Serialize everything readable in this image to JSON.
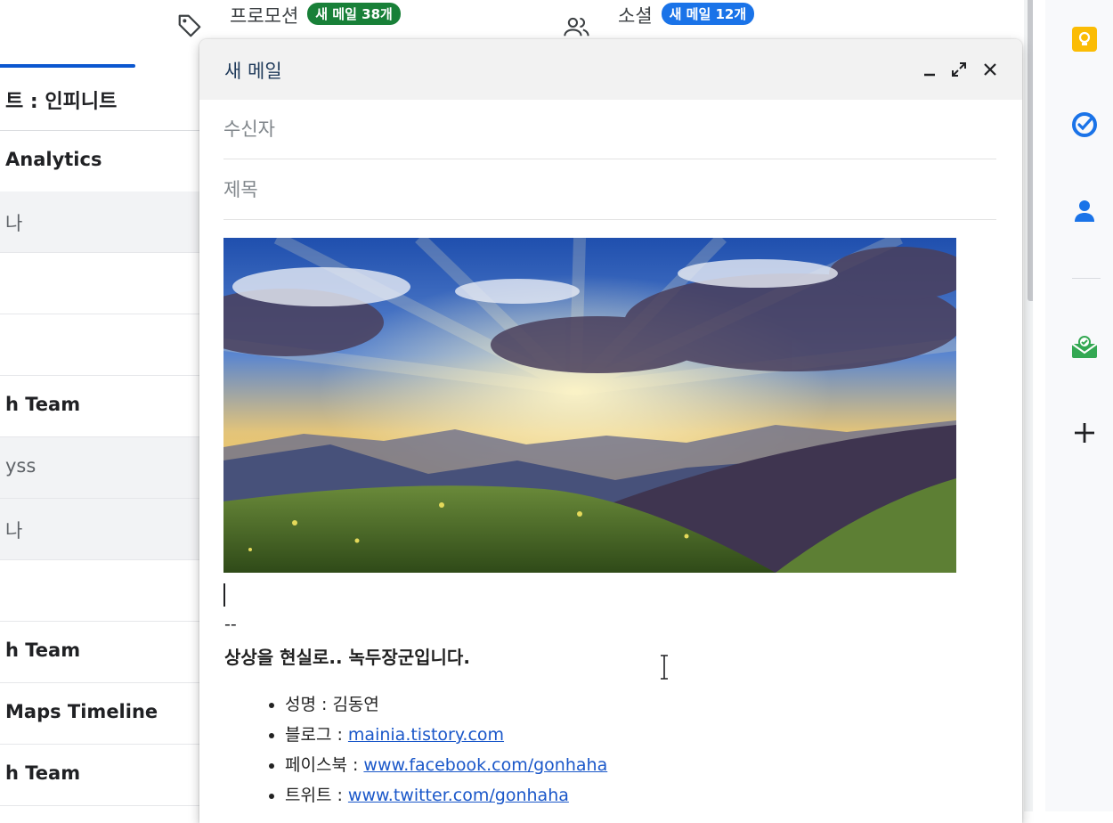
{
  "tabs": {
    "promotions": {
      "label": "프로모션",
      "badge": "새 메일 38개",
      "badge_color": "#188038",
      "icon": "tag-icon"
    },
    "social": {
      "label": "소셜",
      "badge": "새 메일 12개",
      "badge_color": "#1a73e8",
      "icon": "people-icon"
    }
  },
  "list_header": "트 : 인피니트",
  "rows": [
    {
      "text": "Analytics",
      "state": "unread"
    },
    {
      "text": "나",
      "state": "read"
    },
    {
      "text": "",
      "state": "unread"
    },
    {
      "text": "",
      "state": "unread"
    },
    {
      "text": "h Team",
      "state": "unread"
    },
    {
      "text": "yss",
      "state": "read"
    },
    {
      "text": "나",
      "state": "read"
    },
    {
      "text": "",
      "state": "unread"
    },
    {
      "text": "h Team",
      "state": "unread"
    },
    {
      "text": "Maps Timeline",
      "state": "unread"
    },
    {
      "text": "h Team",
      "state": "unread"
    }
  ],
  "compose": {
    "title": "새 메일",
    "to_placeholder": "수신자",
    "subject_placeholder": "제목",
    "buttons": [
      "minimize-icon",
      "expand-icon",
      "close-icon"
    ],
    "signature": {
      "dash": "--",
      "title": "상상을 현실로.. 녹두장군입니다.",
      "items": [
        {
          "label": "성명  : ",
          "value": "김동연",
          "link": false
        },
        {
          "label": "블로그 : ",
          "value": "mainia.tistory.com",
          "link": true
        },
        {
          "label": "페이스북 : ",
          "value": "www.facebook.com/gonhaha",
          "link": true
        },
        {
          "label": "트위트 : ",
          "value": "www.twitter.com/gonhaha",
          "link": true
        }
      ]
    }
  },
  "side_panel": [
    "keep-icon",
    "tasks-icon",
    "contacts-icon",
    "addon-icon",
    "add-icon"
  ],
  "colors": {
    "accent": "#0b57d0",
    "link": "#1a57c9",
    "keep": "#fbbc04",
    "tasks": "#1a73e8"
  }
}
